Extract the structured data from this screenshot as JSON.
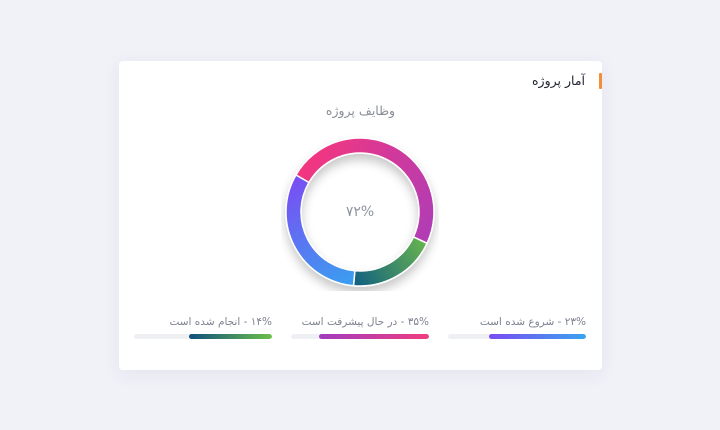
{
  "card": {
    "title": "آمار پروژه",
    "accent_color": "#f48d37"
  },
  "chart_data": {
    "type": "pie",
    "title": "وظایف پروژه",
    "center_label": "۷۲%",
    "series": [
      {
        "name": "شروع شده است",
        "value": 23,
        "colors": [
          "#39a0f0",
          "#7b4cf3"
        ]
      },
      {
        "name": "در حال پیشرفت است",
        "value": 35,
        "colors": [
          "#f4367e",
          "#b03cb6"
        ]
      },
      {
        "name": "انجام شده است",
        "value": 14,
        "colors": [
          "#67b44e",
          "#105e82"
        ]
      }
    ],
    "remainder": 28
  },
  "legend": [
    {
      "label": "۲۳% - شروع شده است",
      "value": 0.7,
      "colors": [
        "#3aa3ee",
        "#7a4cf3"
      ]
    },
    {
      "label": "۳۵% - در حال پیشرفت است",
      "value": 0.8,
      "colors": [
        "#ef3d7f",
        "#a13cbf"
      ]
    },
    {
      "label": "۱۴% - انجام شده است",
      "value": 0.6,
      "colors": [
        "#6cc04a",
        "#0f4f7e"
      ]
    }
  ]
}
